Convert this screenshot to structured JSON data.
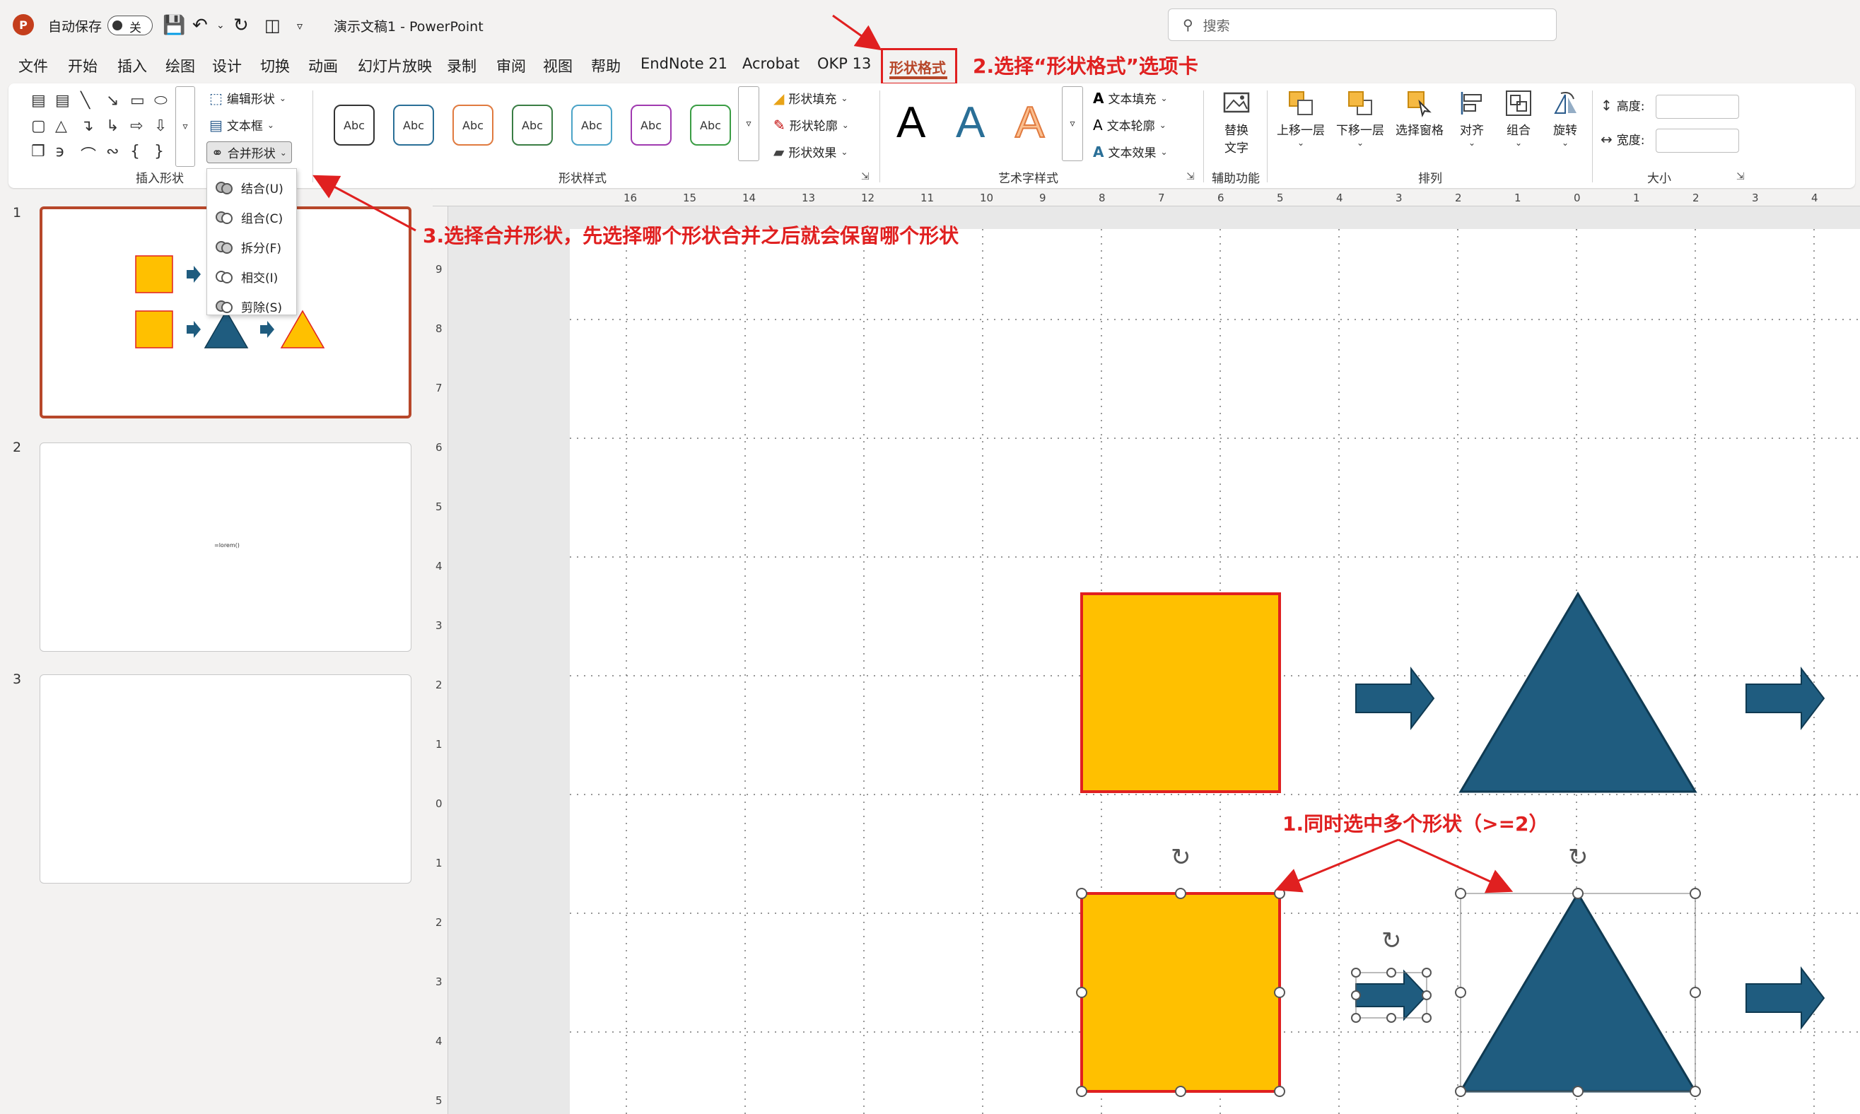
{
  "titlebar": {
    "app_logo": "P",
    "autosave_label": "自动保存",
    "autosave_state": "关",
    "doc_title": "演示文稿1  -  PowerPoint",
    "search_placeholder": "搜索"
  },
  "tabs": [
    "文件",
    "开始",
    "插入",
    "绘图",
    "设计",
    "切换",
    "动画",
    "幻灯片放映",
    "录制",
    "审阅",
    "视图",
    "帮助",
    "EndNote 21",
    "Acrobat",
    "OKP 13"
  ],
  "active_tab": "形状格式",
  "ribbon": {
    "insert_shapes": {
      "label": "插入形状",
      "edit_shape": "编辑形状",
      "text_box": "文本框",
      "merge_shapes": "合并形状"
    },
    "shape_styles": {
      "label": "形状样式",
      "style_sample": "Abc",
      "style_colors": [
        "#333333",
        "#2a6f97",
        "#e07a3f",
        "#3a7d44",
        "#4ba3c7",
        "#a03ab0",
        "#3a9d44"
      ],
      "fill": "形状填充",
      "outline": "形状轮廓",
      "effects": "形状效果"
    },
    "wordart": {
      "label": "艺术字样式",
      "sample": "A",
      "text_fill": "文本填充",
      "text_outline": "文本轮廓",
      "text_effects": "文本效果"
    },
    "accessibility": {
      "label": "辅助功能",
      "alt_text_line1": "替换",
      "alt_text_line2": "文字"
    },
    "arrange": {
      "label": "排列",
      "bring_forward": "上移一层",
      "send_backward": "下移一层",
      "selection_pane": "选择窗格",
      "align": "对齐",
      "group": "组合",
      "rotate": "旋转"
    },
    "size": {
      "label": "大小",
      "height": "高度:",
      "width": "宽度:"
    }
  },
  "merge_menu": [
    "结合(U)",
    "组合(C)",
    "拆分(F)",
    "相交(I)",
    "剪除(S)"
  ],
  "slides": [
    {
      "number": "1"
    },
    {
      "number": "2",
      "text": "=lorem()"
    },
    {
      "number": "3"
    }
  ],
  "ruler": {
    "horizontal": [
      "16",
      "15",
      "14",
      "13",
      "12",
      "11",
      "10",
      "9",
      "8",
      "7",
      "6",
      "5",
      "4",
      "3",
      "2",
      "1",
      "0",
      "1",
      "2",
      "3",
      "4"
    ],
    "vertical": [
      "9",
      "8",
      "7",
      "6",
      "5",
      "4",
      "3",
      "2",
      "1",
      "0",
      "1",
      "2",
      "3",
      "4",
      "5"
    ]
  },
  "colors": {
    "square_fill": "#ffc000",
    "square_stroke": "#e02020",
    "triangle_fill": "#1f5c7f",
    "arrow_fill": "#1f5c7f",
    "accent": "#b7472a",
    "annotation": "#e02020"
  },
  "annotations": {
    "step1": "1.同时选中多个形状（>=2）",
    "step2": "2.选择“形状格式”选项卡",
    "step3": "3.选择合并形状，先选择哪个形状合并之后就会保留哪个形状"
  }
}
